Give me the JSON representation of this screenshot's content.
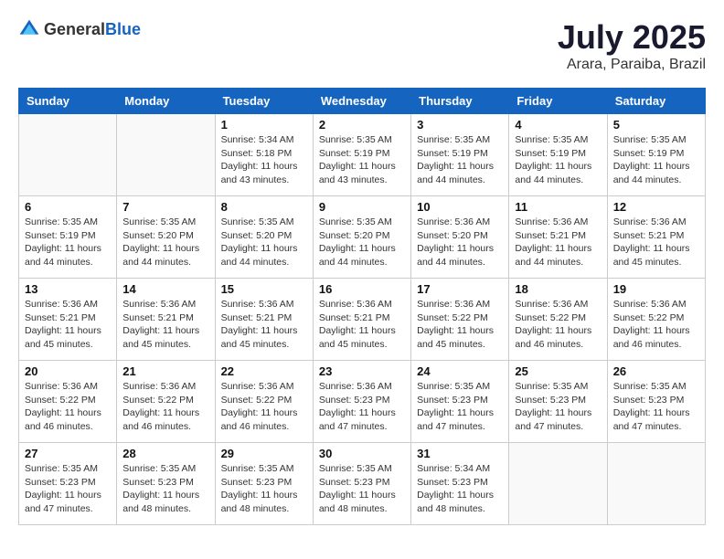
{
  "header": {
    "logo_general": "General",
    "logo_blue": "Blue",
    "month": "July 2025",
    "location": "Arara, Paraiba, Brazil"
  },
  "weekdays": [
    "Sunday",
    "Monday",
    "Tuesday",
    "Wednesday",
    "Thursday",
    "Friday",
    "Saturday"
  ],
  "weeks": [
    [
      {
        "day": "",
        "info": ""
      },
      {
        "day": "",
        "info": ""
      },
      {
        "day": "1",
        "info": "Sunrise: 5:34 AM\nSunset: 5:18 PM\nDaylight: 11 hours and 43 minutes."
      },
      {
        "day": "2",
        "info": "Sunrise: 5:35 AM\nSunset: 5:19 PM\nDaylight: 11 hours and 43 minutes."
      },
      {
        "day": "3",
        "info": "Sunrise: 5:35 AM\nSunset: 5:19 PM\nDaylight: 11 hours and 44 minutes."
      },
      {
        "day": "4",
        "info": "Sunrise: 5:35 AM\nSunset: 5:19 PM\nDaylight: 11 hours and 44 minutes."
      },
      {
        "day": "5",
        "info": "Sunrise: 5:35 AM\nSunset: 5:19 PM\nDaylight: 11 hours and 44 minutes."
      }
    ],
    [
      {
        "day": "6",
        "info": "Sunrise: 5:35 AM\nSunset: 5:19 PM\nDaylight: 11 hours and 44 minutes."
      },
      {
        "day": "7",
        "info": "Sunrise: 5:35 AM\nSunset: 5:20 PM\nDaylight: 11 hours and 44 minutes."
      },
      {
        "day": "8",
        "info": "Sunrise: 5:35 AM\nSunset: 5:20 PM\nDaylight: 11 hours and 44 minutes."
      },
      {
        "day": "9",
        "info": "Sunrise: 5:35 AM\nSunset: 5:20 PM\nDaylight: 11 hours and 44 minutes."
      },
      {
        "day": "10",
        "info": "Sunrise: 5:36 AM\nSunset: 5:20 PM\nDaylight: 11 hours and 44 minutes."
      },
      {
        "day": "11",
        "info": "Sunrise: 5:36 AM\nSunset: 5:21 PM\nDaylight: 11 hours and 44 minutes."
      },
      {
        "day": "12",
        "info": "Sunrise: 5:36 AM\nSunset: 5:21 PM\nDaylight: 11 hours and 45 minutes."
      }
    ],
    [
      {
        "day": "13",
        "info": "Sunrise: 5:36 AM\nSunset: 5:21 PM\nDaylight: 11 hours and 45 minutes."
      },
      {
        "day": "14",
        "info": "Sunrise: 5:36 AM\nSunset: 5:21 PM\nDaylight: 11 hours and 45 minutes."
      },
      {
        "day": "15",
        "info": "Sunrise: 5:36 AM\nSunset: 5:21 PM\nDaylight: 11 hours and 45 minutes."
      },
      {
        "day": "16",
        "info": "Sunrise: 5:36 AM\nSunset: 5:21 PM\nDaylight: 11 hours and 45 minutes."
      },
      {
        "day": "17",
        "info": "Sunrise: 5:36 AM\nSunset: 5:22 PM\nDaylight: 11 hours and 45 minutes."
      },
      {
        "day": "18",
        "info": "Sunrise: 5:36 AM\nSunset: 5:22 PM\nDaylight: 11 hours and 46 minutes."
      },
      {
        "day": "19",
        "info": "Sunrise: 5:36 AM\nSunset: 5:22 PM\nDaylight: 11 hours and 46 minutes."
      }
    ],
    [
      {
        "day": "20",
        "info": "Sunrise: 5:36 AM\nSunset: 5:22 PM\nDaylight: 11 hours and 46 minutes."
      },
      {
        "day": "21",
        "info": "Sunrise: 5:36 AM\nSunset: 5:22 PM\nDaylight: 11 hours and 46 minutes."
      },
      {
        "day": "22",
        "info": "Sunrise: 5:36 AM\nSunset: 5:22 PM\nDaylight: 11 hours and 46 minutes."
      },
      {
        "day": "23",
        "info": "Sunrise: 5:36 AM\nSunset: 5:23 PM\nDaylight: 11 hours and 47 minutes."
      },
      {
        "day": "24",
        "info": "Sunrise: 5:35 AM\nSunset: 5:23 PM\nDaylight: 11 hours and 47 minutes."
      },
      {
        "day": "25",
        "info": "Sunrise: 5:35 AM\nSunset: 5:23 PM\nDaylight: 11 hours and 47 minutes."
      },
      {
        "day": "26",
        "info": "Sunrise: 5:35 AM\nSunset: 5:23 PM\nDaylight: 11 hours and 47 minutes."
      }
    ],
    [
      {
        "day": "27",
        "info": "Sunrise: 5:35 AM\nSunset: 5:23 PM\nDaylight: 11 hours and 47 minutes."
      },
      {
        "day": "28",
        "info": "Sunrise: 5:35 AM\nSunset: 5:23 PM\nDaylight: 11 hours and 48 minutes."
      },
      {
        "day": "29",
        "info": "Sunrise: 5:35 AM\nSunset: 5:23 PM\nDaylight: 11 hours and 48 minutes."
      },
      {
        "day": "30",
        "info": "Sunrise: 5:35 AM\nSunset: 5:23 PM\nDaylight: 11 hours and 48 minutes."
      },
      {
        "day": "31",
        "info": "Sunrise: 5:34 AM\nSunset: 5:23 PM\nDaylight: 11 hours and 48 minutes."
      },
      {
        "day": "",
        "info": ""
      },
      {
        "day": "",
        "info": ""
      }
    ]
  ]
}
